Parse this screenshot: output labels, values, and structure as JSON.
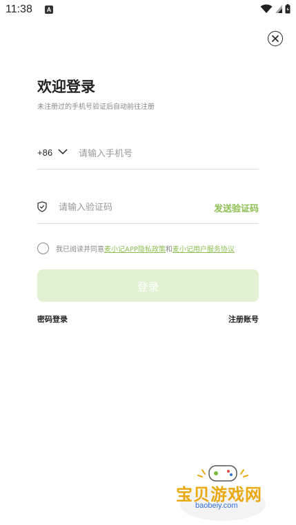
{
  "status_bar": {
    "time": "11:38",
    "notification_letter": "A",
    "icons": [
      "wifi-icon",
      "signal-icon",
      "battery-icon"
    ]
  },
  "login": {
    "title": "欢迎登录",
    "subtitle": "未注册过的手机号验证后自动前往注册",
    "country_code": "+86",
    "phone_placeholder": "请输入手机号",
    "code_placeholder": "请输入验证码",
    "send_code_label": "发送验证码",
    "agreement_prefix": "我已阅读并同意",
    "privacy_link": "麦小记APP隐私政策",
    "agreement_and": "和",
    "service_link": "麦小记用户服务协议",
    "login_button_label": "登录",
    "password_login_label": "密码登录",
    "register_label": "注册账号"
  },
  "watermark": {
    "title": "宝贝游戏网",
    "url": "baobeiy.com"
  },
  "colors": {
    "accent": "#8cc052",
    "button_disabled": "#e1f1d2",
    "watermark_gold": "#e8a80e"
  }
}
